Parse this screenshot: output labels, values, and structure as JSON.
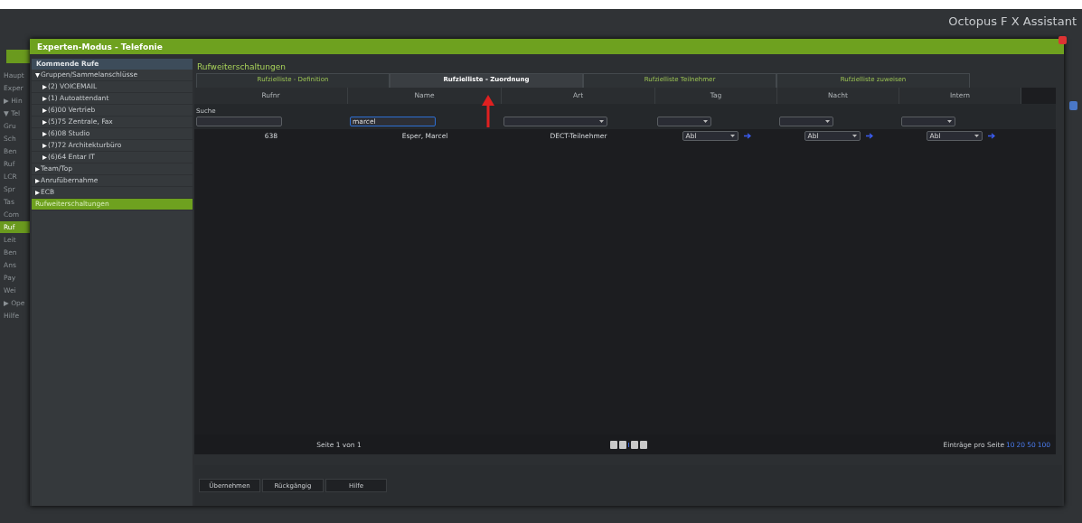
{
  "app": {
    "title": "Octopus F X Assistant",
    "sidebar": [
      {
        "label": "Haupt",
        "selected": false
      },
      {
        "label": "Exper",
        "selected": false
      },
      {
        "label": "▶ Hin",
        "selected": false
      },
      {
        "label": "▼ Tel",
        "selected": false
      },
      {
        "label": "Gru",
        "selected": false
      },
      {
        "label": "Sch",
        "selected": false
      },
      {
        "label": "Ben",
        "selected": false
      },
      {
        "label": "Ruf",
        "selected": false
      },
      {
        "label": "LCR",
        "selected": false
      },
      {
        "label": "Spr",
        "selected": false
      },
      {
        "label": "Tas",
        "selected": false
      },
      {
        "label": "Com",
        "selected": false
      },
      {
        "label": "Ruf",
        "selected": true
      },
      {
        "label": "Leit",
        "selected": false
      },
      {
        "label": "Ben",
        "selected": false
      },
      {
        "label": "Ans",
        "selected": false
      },
      {
        "label": "Pay",
        "selected": false
      },
      {
        "label": "Wei",
        "selected": false
      },
      {
        "label": "▶ Ope",
        "selected": false
      },
      {
        "label": "Hilfe",
        "selected": false
      }
    ]
  },
  "dialog": {
    "title": "Experten-Modus - Telefonie",
    "tree": {
      "header": "Kommende Rufe",
      "items": [
        {
          "label": "Gruppen/Sammelanschlüsse",
          "expanded": true,
          "selected": false,
          "children": [
            {
              "label": "(2) VOICEMAIL",
              "expanded": false,
              "selected": false
            },
            {
              "label": "(1) Autoattendant",
              "expanded": false,
              "selected": false
            },
            {
              "label": "(6)00 Vertrieb",
              "expanded": false,
              "selected": false
            },
            {
              "label": "(5)75 Zentrale, Fax",
              "expanded": false,
              "selected": false
            },
            {
              "label": "(6)08 Studio",
              "expanded": false,
              "selected": false
            },
            {
              "label": "(7)72 Architekturbüro",
              "expanded": false,
              "selected": false
            },
            {
              "label": "(6)64 Entar IT",
              "expanded": false,
              "selected": false
            }
          ]
        },
        {
          "label": "Team/Top",
          "expanded": false,
          "selected": false
        },
        {
          "label": "Anrufübernahme",
          "expanded": false,
          "selected": false
        },
        {
          "label": "ECB",
          "expanded": false,
          "selected": false
        },
        {
          "label": "Rufweiterschaltungen",
          "selected": true
        }
      ]
    },
    "heading": "Rufweiterschaltungen",
    "tabs": [
      {
        "label": "Rufzielliste - Definition",
        "selected": false
      },
      {
        "label": "Rufzielliste - Zuordnung",
        "selected": true
      },
      {
        "label": "Rufzielliste Teilnehmer",
        "selected": false
      },
      {
        "label": "Rufzielliste zuweisen",
        "selected": false
      }
    ],
    "table": {
      "columns": [
        "Rufnr",
        "Name",
        "Art",
        "Tag",
        "Nacht",
        "Intern"
      ],
      "search_label": "Suche",
      "filters": [
        {
          "kind": "text"
        },
        {
          "kind": "text",
          "value": "marcel"
        },
        {
          "kind": "select"
        },
        {
          "kind": "select"
        },
        {
          "kind": "select"
        },
        {
          "kind": "select"
        }
      ],
      "rows": [
        {
          "cells": [
            {
              "kind": "text",
              "value": "638"
            },
            {
              "kind": "text",
              "value": "Esper, Marcel"
            },
            {
              "kind": "text",
              "value": "DECT-Teilnehmer"
            },
            {
              "kind": "select",
              "value": "Abl"
            },
            {
              "kind": "select",
              "value": "Abl"
            },
            {
              "kind": "select",
              "value": "Abl"
            }
          ]
        }
      ]
    },
    "pager": {
      "page": "Seite 1 von 1",
      "per_page_label": "Einträge pro Seite",
      "per_page": [
        "10",
        "20",
        "50",
        "100"
      ]
    },
    "buttons": [
      "Übernehmen",
      "Rückgängig",
      "Hilfe"
    ]
  }
}
